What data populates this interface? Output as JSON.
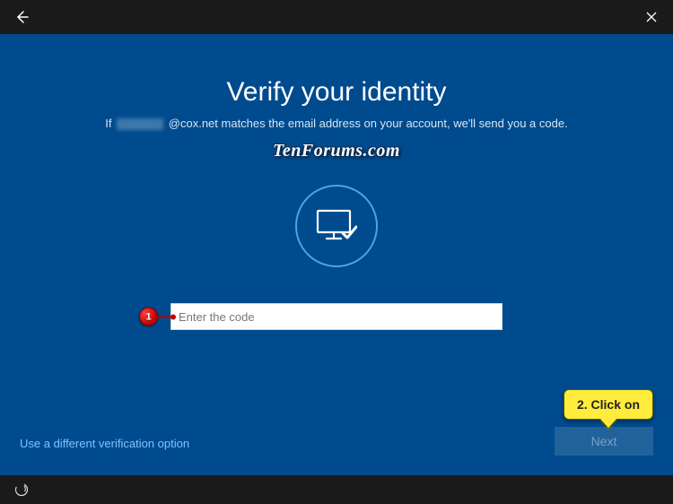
{
  "topbar": {
    "back_label": "Back",
    "close_label": "Close"
  },
  "page": {
    "title": "Verify your identity",
    "subtitle_prefix": "If",
    "subtitle_domain": "@cox.net matches the email address on your account, we'll send you a code."
  },
  "watermark": "TenForums.com",
  "input": {
    "placeholder": "Enter the code"
  },
  "annotations": {
    "step1_num": "1",
    "step2_text": "2. Click on"
  },
  "links": {
    "alt_option": "Use a different verification option"
  },
  "buttons": {
    "next": "Next"
  },
  "bottombar": {
    "ease_label": "Ease of access"
  }
}
